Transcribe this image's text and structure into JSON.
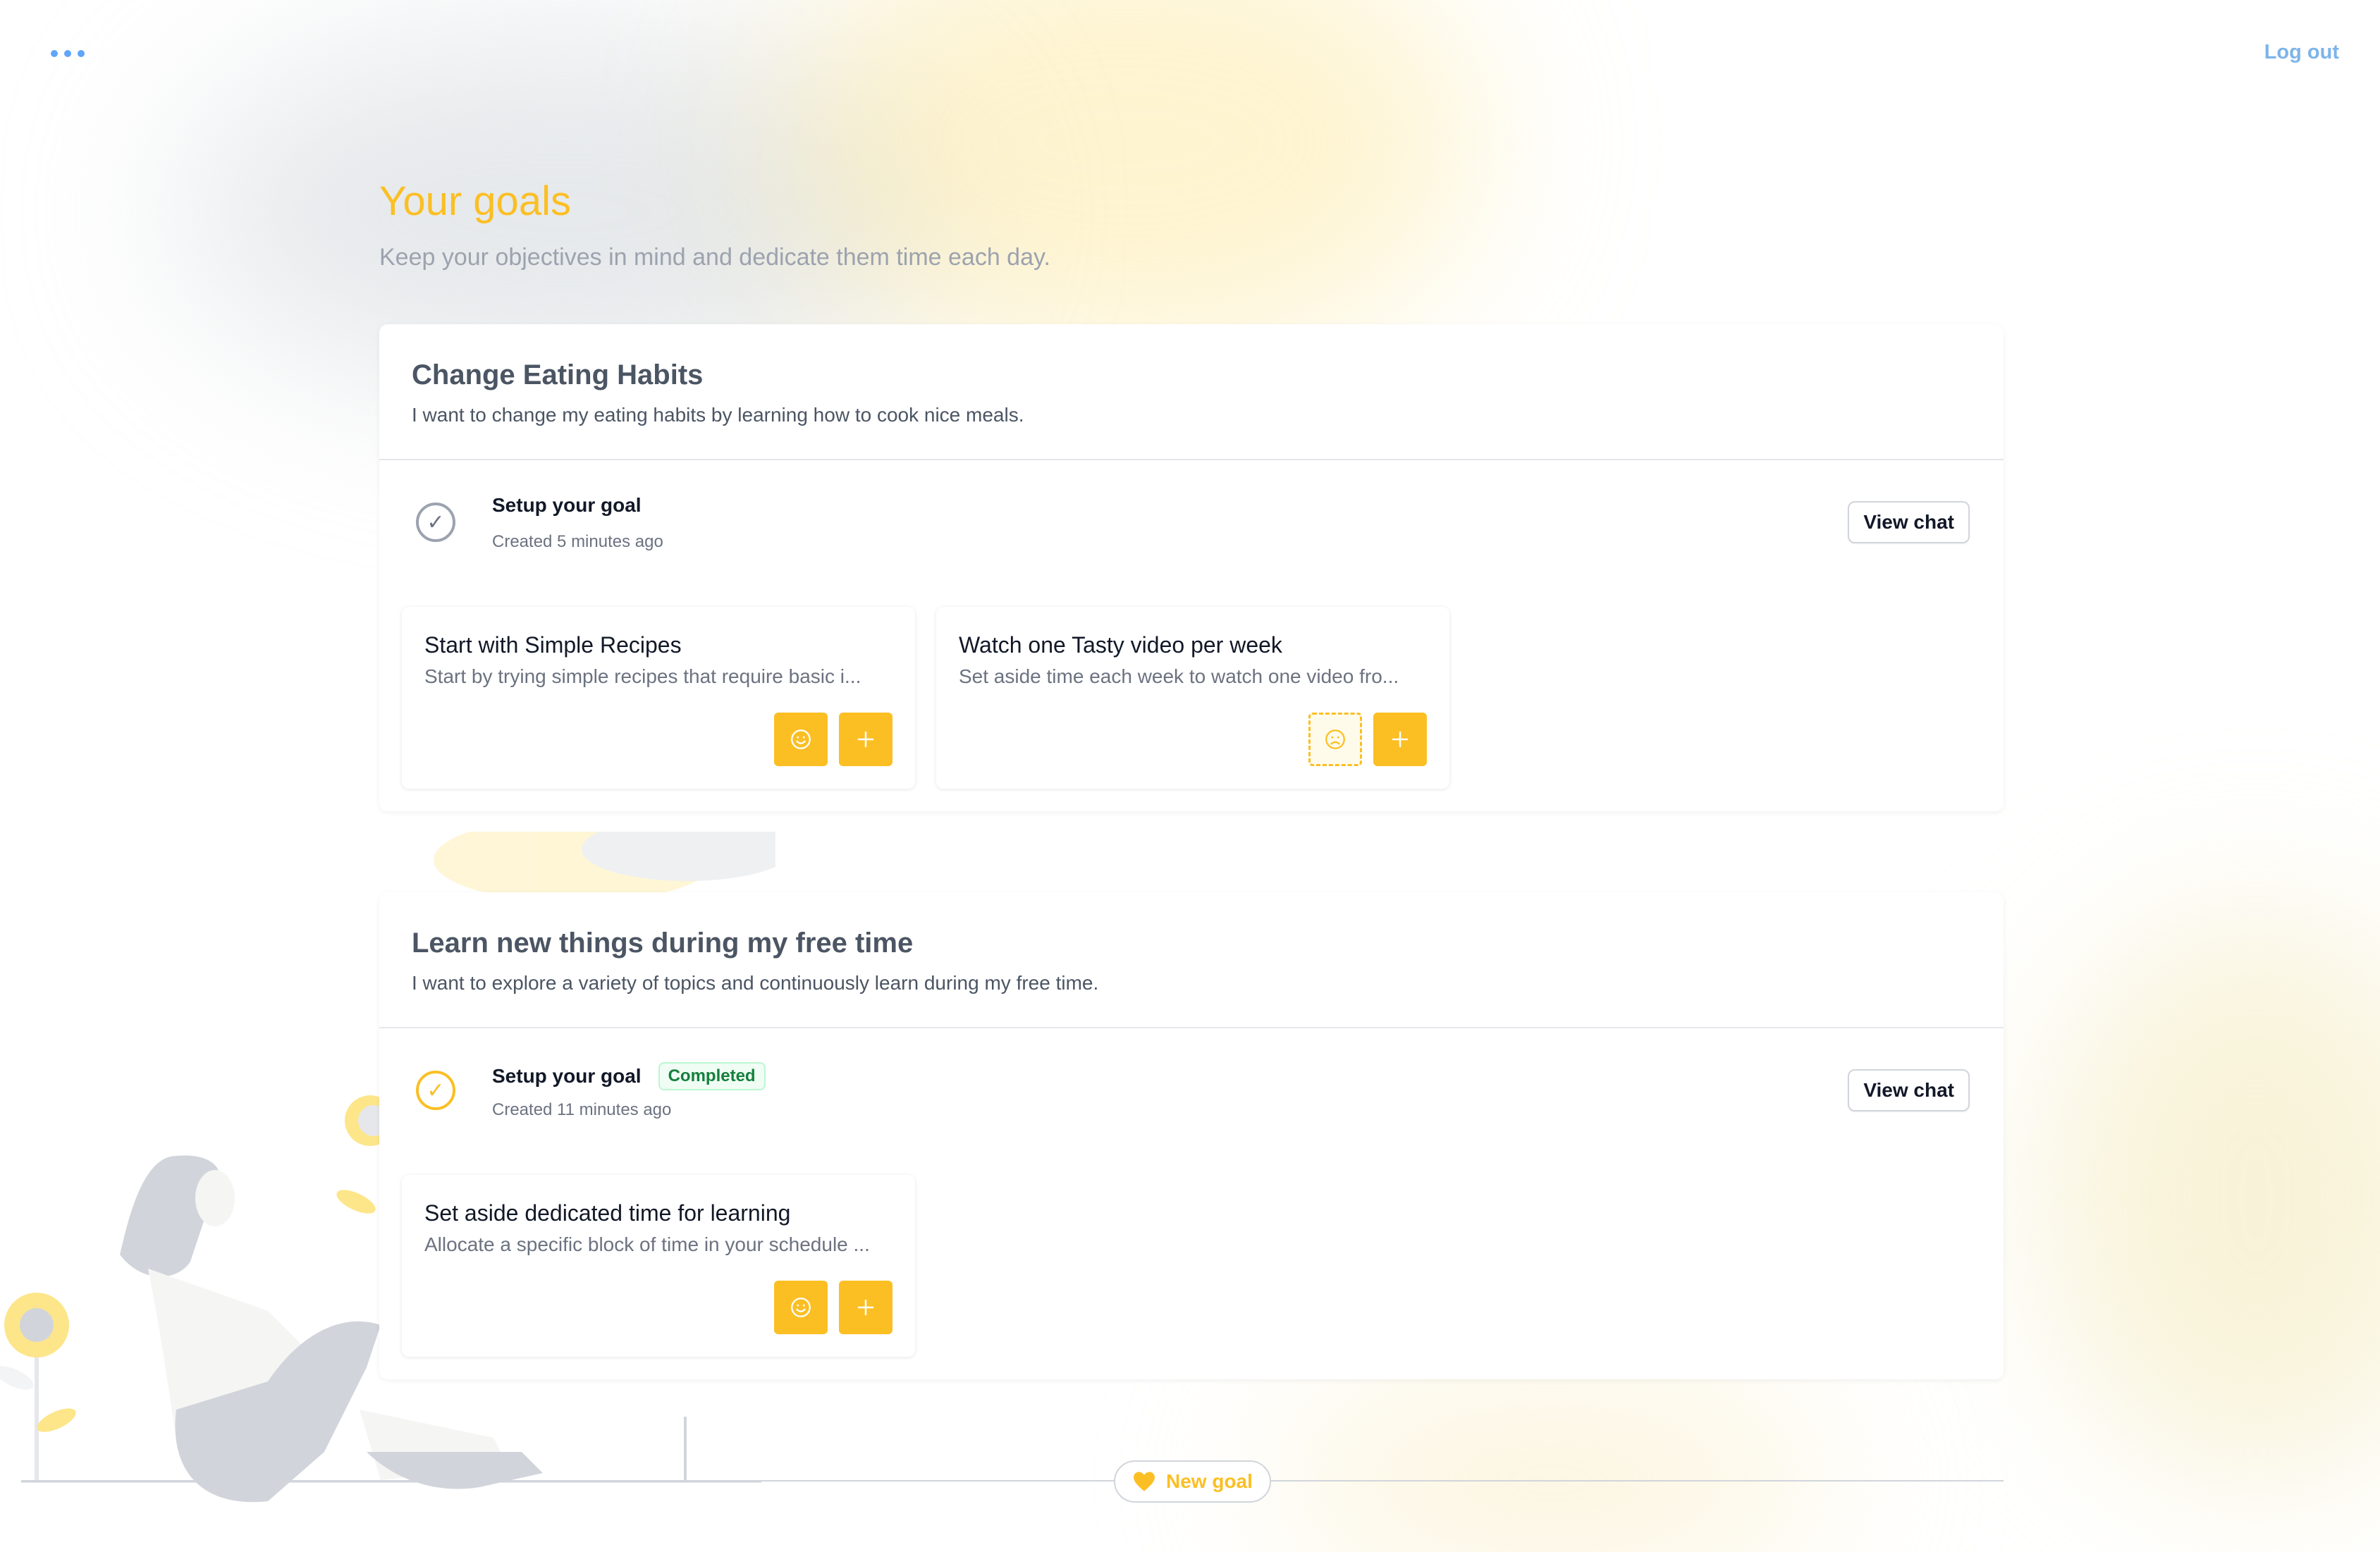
{
  "header": {
    "menu_icon": "ellipsis-icon",
    "logout_label": "Log out"
  },
  "page": {
    "title": "Your goals",
    "subtitle": "Keep your objectives in mind and dedicate them time each day."
  },
  "goals": [
    {
      "title": "Change Eating Habits",
      "description": "I want to change my eating habits by learning how to cook nice meals.",
      "step": {
        "title": "Setup your goal",
        "meta": "Created 5 minutes ago",
        "badge": "",
        "completed": false,
        "action_label": "View chat"
      },
      "tasks": [
        {
          "title": "Start with Simple Recipes",
          "description": "Start by trying simple recipes that require basic i...",
          "mood_icon": "smile-icon",
          "mood_active": true
        },
        {
          "title": "Watch one Tasty video per week",
          "description": "Set aside time each week to watch one video fro...",
          "mood_icon": "frown-icon",
          "mood_active": false
        }
      ]
    },
    {
      "title": "Learn new things during my free time",
      "description": "I want to explore a variety of topics and continuously learn during my free time.",
      "step": {
        "title": "Setup your goal",
        "meta": "Created 11 minutes ago",
        "badge": "Completed",
        "completed": true,
        "action_label": "View chat"
      },
      "tasks": [
        {
          "title": "Set aside dedicated time for learning",
          "description": "Allocate a specific block of time in your schedule ...",
          "mood_icon": "smile-icon",
          "mood_active": true
        }
      ]
    }
  ],
  "footer": {
    "new_goal_label": "New goal",
    "new_goal_icon": "heart-icon"
  },
  "colors": {
    "accent": "#fbbf24",
    "link": "#7db4ea",
    "success": "#15803d"
  }
}
